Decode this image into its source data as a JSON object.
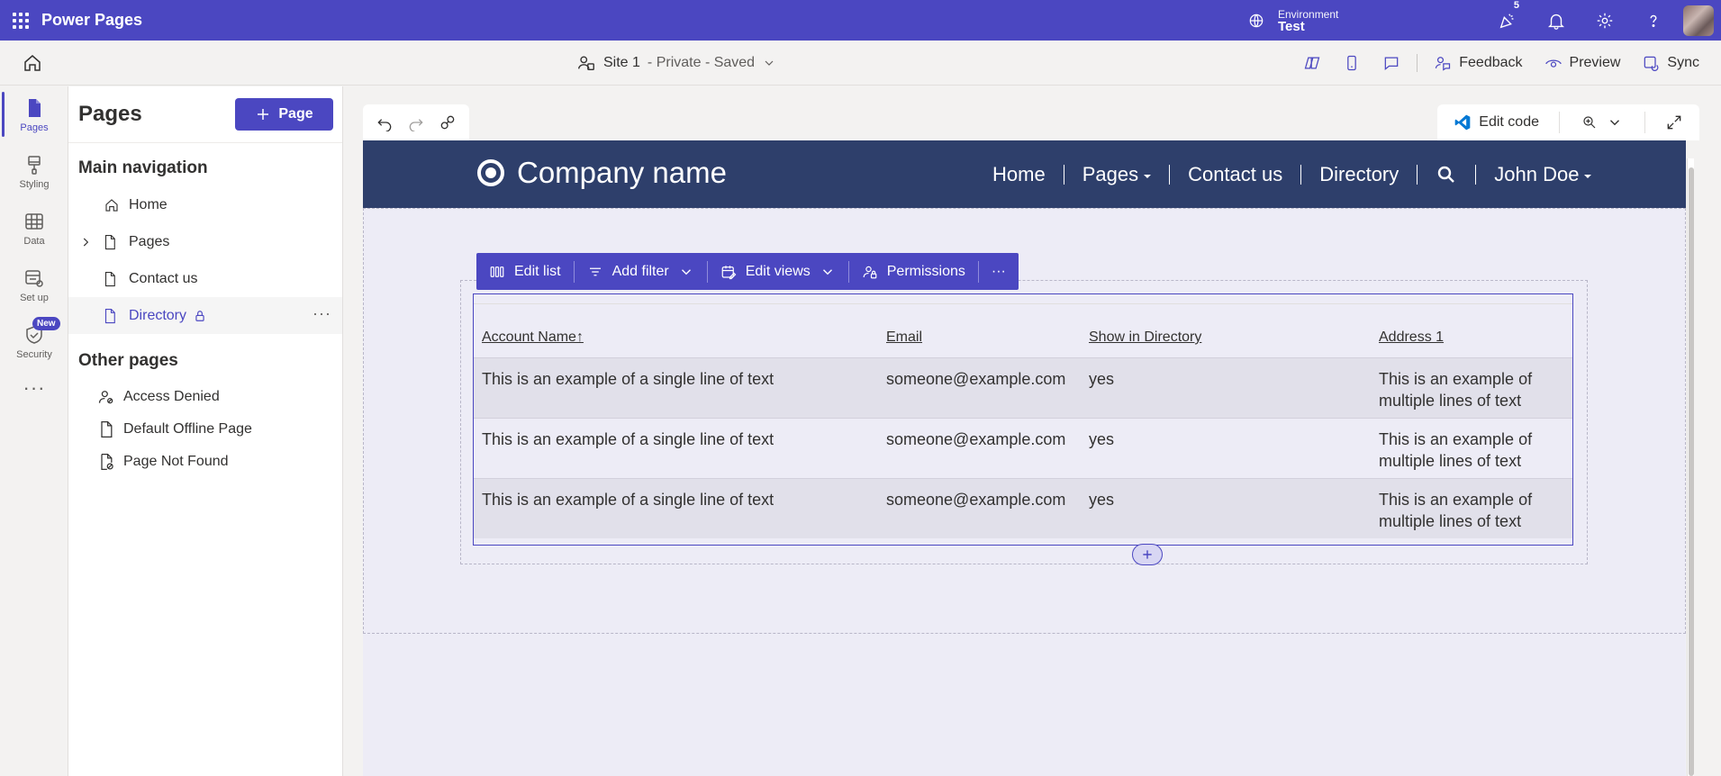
{
  "app": {
    "title": "Power Pages"
  },
  "environment": {
    "label": "Environment",
    "value": "Test"
  },
  "notifications": {
    "count": "5"
  },
  "site": {
    "name": "Site 1",
    "status": " - Private - Saved"
  },
  "command_bar": {
    "feedback": "Feedback",
    "preview": "Preview",
    "sync": "Sync"
  },
  "rail": {
    "items": [
      {
        "label": "Pages",
        "icon": "page-icon"
      },
      {
        "label": "Styling",
        "icon": "brush-icon"
      },
      {
        "label": "Data",
        "icon": "table-icon"
      },
      {
        "label": "Set up",
        "icon": "setup-icon"
      },
      {
        "label": "Security",
        "icon": "shield-icon",
        "badge": "New"
      }
    ],
    "more": "···"
  },
  "panel": {
    "title": "Pages",
    "add_button": "Page",
    "main_nav_title": "Main navigation",
    "main_nav": [
      {
        "label": "Home"
      },
      {
        "label": "Pages"
      },
      {
        "label": "Contact us"
      },
      {
        "label": "Directory"
      }
    ],
    "other_title": "Other pages",
    "other_pages": [
      {
        "label": "Access Denied"
      },
      {
        "label": "Default Offline Page"
      },
      {
        "label": "Page Not Found"
      }
    ]
  },
  "canvas_toolbar": {
    "edit_code": "Edit code"
  },
  "site_header": {
    "brand": "Company name",
    "nav": [
      "Home",
      "Pages",
      "Contact us",
      "Directory",
      "John Doe"
    ]
  },
  "list_toolbar": {
    "edit_list": "Edit list",
    "add_filter": "Add filter",
    "edit_views": "Edit views",
    "permissions": "Permissions",
    "more": "···"
  },
  "list": {
    "columns": [
      "Account Name",
      "Email",
      "Show in Directory",
      "Address 1"
    ],
    "sort_indicator": "↑",
    "rows": [
      {
        "account": "This is an example of a single line of text",
        "email": "someone@example.com",
        "show": "yes",
        "address_l1": "This is an example of",
        "address_l2": "multiple lines of text"
      },
      {
        "account": "This is an example of a single line of text",
        "email": "someone@example.com",
        "show": "yes",
        "address_l1": "This is an example of",
        "address_l2": "multiple lines of text"
      },
      {
        "account": "This is an example of a single line of text",
        "email": "someone@example.com",
        "show": "yes",
        "address_l1": "This is an example of",
        "address_l2": "multiple lines of text"
      }
    ]
  },
  "colors": {
    "accent": "#4b47c1",
    "site_header": "#2e3f6b"
  }
}
